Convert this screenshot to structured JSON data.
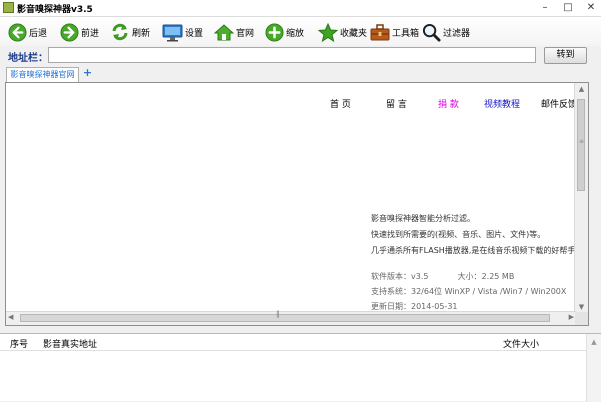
{
  "window": {
    "title": "影音嗅探神器v3.5",
    "controls": [
      "minimize",
      "maximize",
      "close"
    ]
  },
  "toolbar": {
    "buttons": [
      {
        "label": "后退",
        "icon": "arrow-left-icon"
      },
      {
        "label": "前进",
        "icon": "arrow-right-icon"
      },
      {
        "label": "刷新",
        "icon": "refresh-icon"
      },
      {
        "label": "设置",
        "icon": "monitor-icon"
      },
      {
        "label": "官网",
        "icon": "home-icon"
      },
      {
        "label": "缩放",
        "icon": "plus-circle-icon"
      },
      {
        "label": "收藏夹",
        "icon": "star-icon"
      },
      {
        "label": "工具箱",
        "icon": "toolbox-icon"
      },
      {
        "label": "过滤器",
        "icon": "magnifier-icon"
      }
    ]
  },
  "address_bar": {
    "label": "地址栏：",
    "value": "",
    "go_label": "转到"
  },
  "tabs": [
    {
      "label": "影音嗅探神器官网",
      "active": true
    }
  ],
  "tab_add_symbol": "+",
  "page": {
    "nav": [
      {
        "label": "首 页",
        "color": "#000000"
      },
      {
        "label": "留 言",
        "color": "#000000"
      },
      {
        "label": "捐 款",
        "color": "#e000e0"
      },
      {
        "label": "视频教程",
        "color": "#1414cc"
      },
      {
        "label": "邮件反馈",
        "color": "#000000"
      }
    ],
    "intro": [
      "影音嗅探神器智能分析过滤。",
      "快速找到所需要的(视频、音乐、图片、文件)等。",
      "几乎通杀所有FLASH播放器,是在线音乐视频下载的好帮手。"
    ],
    "version_label": "软件版本：",
    "version": "v3.5",
    "size_label": "大小：",
    "size": "2.25 MB",
    "system_label": "支持系统：",
    "system": "32/64位  WinXP / Vista /Win7 / Win200X",
    "date_label": "更新日期：",
    "date": "2014-05-31"
  },
  "file_list": {
    "columns": [
      "序号",
      "影音真实地址",
      "文件大小"
    ],
    "rows": []
  },
  "colors": {
    "accent_blue": "#1e6fd4",
    "icon_green": "#4caf2c"
  }
}
